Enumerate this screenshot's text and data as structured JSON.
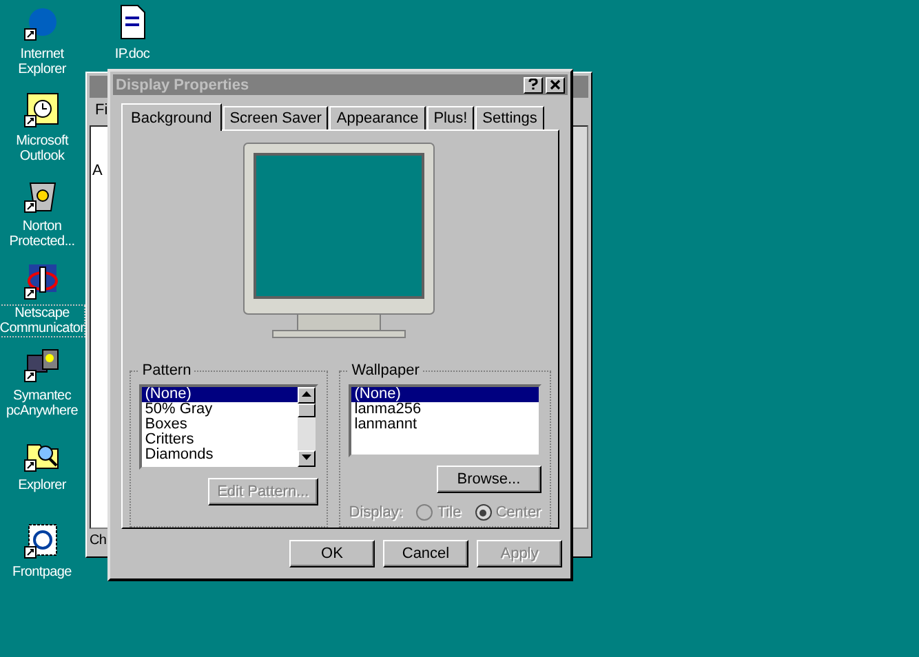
{
  "desktop_icons": [
    {
      "label": "Internet Explorer",
      "kind": "globe",
      "selected": false
    },
    {
      "label": "Microsoft Outlook",
      "kind": "outlook",
      "selected": false
    },
    {
      "label": "Norton Protected...",
      "kind": "bin",
      "selected": false
    },
    {
      "label": "Netscape Communicator",
      "kind": "netscape",
      "selected": true
    },
    {
      "label": "Symantec pcAnywhere",
      "kind": "pcanywhere",
      "selected": false
    },
    {
      "label": "Explorer",
      "kind": "explorer",
      "selected": false
    },
    {
      "label": "Frontpage",
      "kind": "frontpage",
      "selected": false
    }
  ],
  "second_column_icons": [
    {
      "label": "IP.doc",
      "kind": "doc",
      "selected": false
    }
  ],
  "back_window": {
    "menu_text": "Fi",
    "body_text": "A",
    "status_text": "Ch"
  },
  "dialog": {
    "title": "Display Properties",
    "tabs": [
      {
        "label": "Background",
        "selected": true
      },
      {
        "label": "Screen Saver",
        "selected": false
      },
      {
        "label": "Appearance",
        "selected": false
      },
      {
        "label": "Plus!",
        "selected": false
      },
      {
        "label": "Settings",
        "selected": false
      }
    ],
    "pattern": {
      "title": "Pattern",
      "items": [
        {
          "label": "(None)",
          "selected": true
        },
        {
          "label": "50% Gray",
          "selected": false
        },
        {
          "label": "Boxes",
          "selected": false
        },
        {
          "label": "Critters",
          "selected": false
        },
        {
          "label": "Diamonds",
          "selected": false
        }
      ],
      "button": {
        "label": "Edit Pattern...",
        "disabled": true
      }
    },
    "wallpaper": {
      "title": "Wallpaper",
      "items": [
        {
          "label": "(None)",
          "selected": true
        },
        {
          "label": "lanma256",
          "selected": false
        },
        {
          "label": "lanmannt",
          "selected": false
        }
      ],
      "button": {
        "label": "Browse...",
        "disabled": false
      },
      "display_label": "Display:",
      "display_disabled": true,
      "options": [
        {
          "label": "Tile",
          "selected": false
        },
        {
          "label": "Center",
          "selected": true
        }
      ]
    },
    "buttons": [
      {
        "label": "OK",
        "disabled": false
      },
      {
        "label": "Cancel",
        "disabled": false
      },
      {
        "label": "Apply",
        "disabled": true
      }
    ]
  }
}
